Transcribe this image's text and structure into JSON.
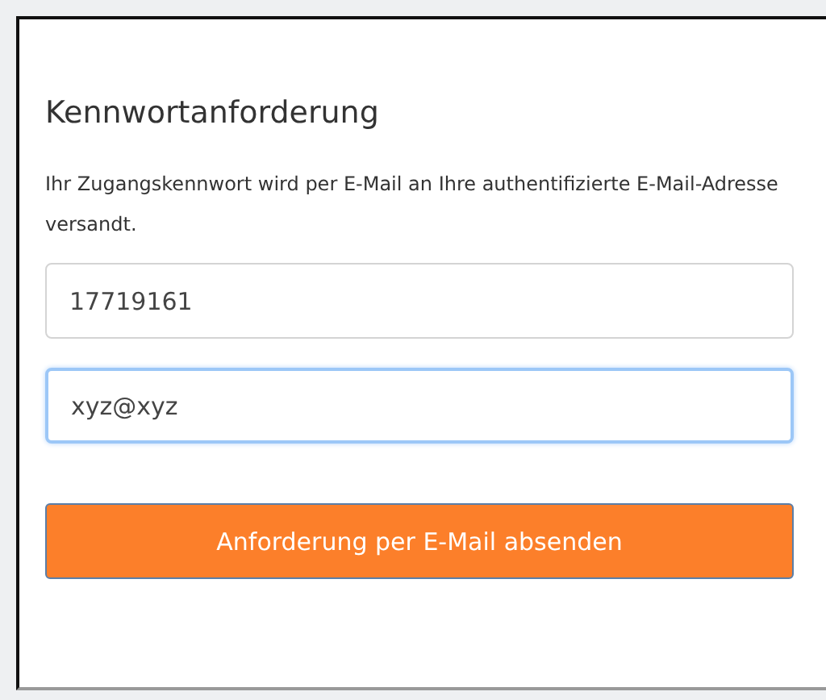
{
  "dialog": {
    "title": "Kennwortanforderung",
    "description": "Ihr Zugangskennwort wird per E-Mail an Ihre authentifizierte E-Mail-Adresse versandt.",
    "fields": [
      {
        "value": "17719161",
        "focused": false
      },
      {
        "value": "xyz@xyz",
        "focused": true
      }
    ],
    "submit_button": "Anforderung per E-Mail absenden"
  }
}
